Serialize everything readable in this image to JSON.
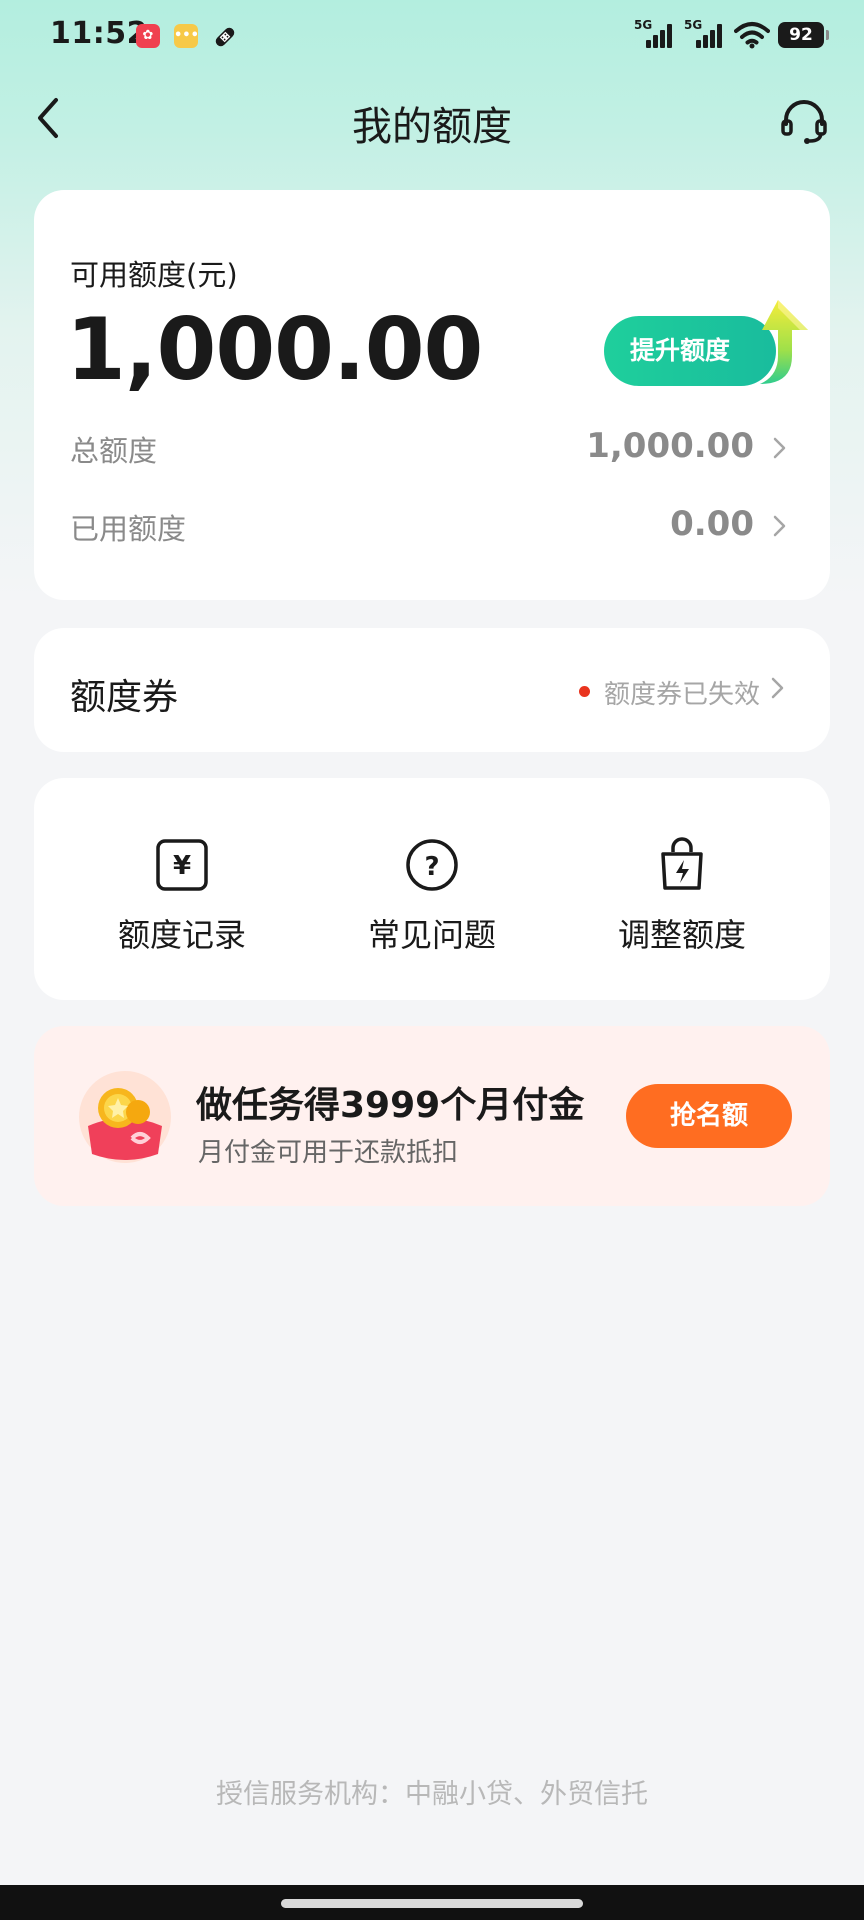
{
  "status_bar": {
    "time": "11:52",
    "battery": "92",
    "network_1": "5G",
    "network_2": "5G"
  },
  "nav": {
    "title": "我的额度"
  },
  "credit": {
    "available_label": "可用额度(元)",
    "available_amount": "1,000.00",
    "raise_button": "提升额度",
    "total_label": "总额度",
    "total_value": "1,000.00",
    "used_label": "已用额度",
    "used_value": "0.00"
  },
  "coupon": {
    "title": "额度券",
    "status": "额度券已失效"
  },
  "menu": {
    "items": [
      {
        "label": "额度记录",
        "icon": "yen-record-icon"
      },
      {
        "label": "常见问题",
        "icon": "question-icon"
      },
      {
        "label": "调整额度",
        "icon": "shopping-bag-bolt-icon"
      }
    ]
  },
  "promo": {
    "title": "做任务得3999个月付金",
    "subtitle": "月付金可用于还款抵扣",
    "button": "抢名额"
  },
  "footer": {
    "text": "授信服务机构：中融小贷、外贸信托"
  },
  "colors": {
    "accent_green": "#1fcf9c",
    "promo_orange": "#ff6d21",
    "alert_red": "#e9341e"
  }
}
